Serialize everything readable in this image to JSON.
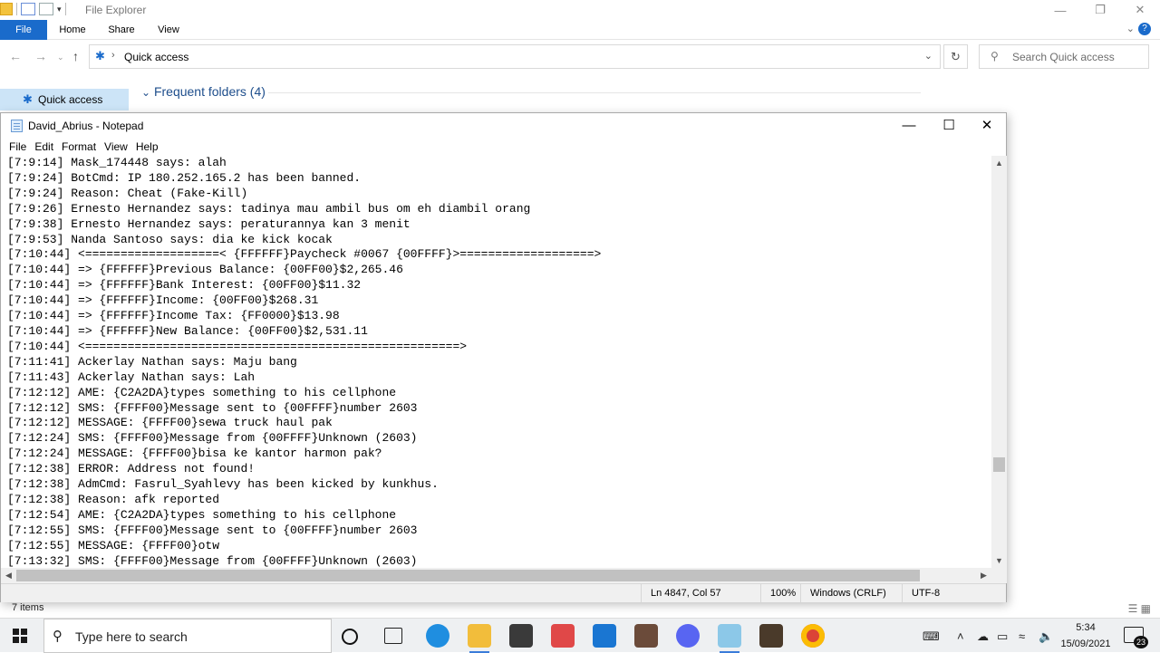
{
  "explorer": {
    "title": "File Explorer",
    "ribbon_tabs": [
      "File",
      "Home",
      "Share",
      "View"
    ],
    "address_path": "Quick access",
    "search_placeholder": "Search Quick access",
    "sidebar_item": "Quick access",
    "frequent_folders": "Frequent folders (4)",
    "status_items": "7 items"
  },
  "notepad": {
    "title": "David_Abrius - Notepad",
    "menu": [
      "File",
      "Edit",
      "Format",
      "View",
      "Help"
    ],
    "lines": [
      "[7:9:14] Mask_174448 says: alah",
      "[7:9:24] BotCmd: IP 180.252.165.2 has been banned.",
      "[7:9:24] Reason: Cheat (Fake-Kill)",
      "[7:9:26] Ernesto Hernandez says: tadinya mau ambil bus om eh diambil orang",
      "[7:9:38] Ernesto Hernandez says: peraturannya kan 3 menit",
      "[7:9:53] Nanda Santoso says: dia ke kick kocak",
      "[7:10:44] <===================< {FFFFFF}Paycheck #0067 {00FFFF}>===================>",
      "[7:10:44] => {FFFFFF}Previous Balance: {00FF00}$2,265.46",
      "[7:10:44] => {FFFFFF}Bank Interest: {00FF00}$11.32",
      "[7:10:44] => {FFFFFF}Income: {00FF00}$268.31",
      "[7:10:44] => {FFFFFF}Income Tax: {FF0000}$13.98",
      "[7:10:44] => {FFFFFF}New Balance: {00FF00}$2,531.11",
      "[7:10:44] <=====================================================>",
      "[7:11:41] Ackerlay Nathan says: Maju bang",
      "[7:11:43] Ackerlay Nathan says: Lah",
      "[7:12:12] AME: {C2A2DA}types something to his cellphone",
      "[7:12:12] SMS: {FFFF00}Message sent to {00FFFF}number 2603",
      "[7:12:12] MESSAGE: {FFFF00}sewa truck haul pak",
      "[7:12:24] SMS: {FFFF00}Message from {00FFFF}Unknown (2603)",
      "[7:12:24] MESSAGE: {FFFF00}bisa ke kantor harmon pak?",
      "[7:12:38] ERROR: Address not found!",
      "[7:12:38] AdmCmd: Fasrul_Syahlevy has been kicked by kunkhus.",
      "[7:12:38] Reason: afk reported",
      "[7:12:54] AME: {C2A2DA}types something to his cellphone",
      "[7:12:55] SMS: {FFFF00}Message sent to {00FFFF}number 2603",
      "[7:12:55] MESSAGE: {FFFF00}otw",
      "[7:13:32] SMS: {FFFF00}Message from {00FFFF}Unknown (2603)"
    ],
    "status": {
      "position": "Ln 4847, Col 57",
      "zoom": "100%",
      "line_ending": "Windows (CRLF)",
      "encoding": "UTF-8"
    },
    "scroll_position_fraction": 0.78
  },
  "taskbar": {
    "search_placeholder": "Type here to search",
    "time": "5:34",
    "date": "15/09/2021",
    "notification_count": "23"
  },
  "colors": {
    "accent": "#1a6bcb",
    "selection": "#cce4f7"
  }
}
